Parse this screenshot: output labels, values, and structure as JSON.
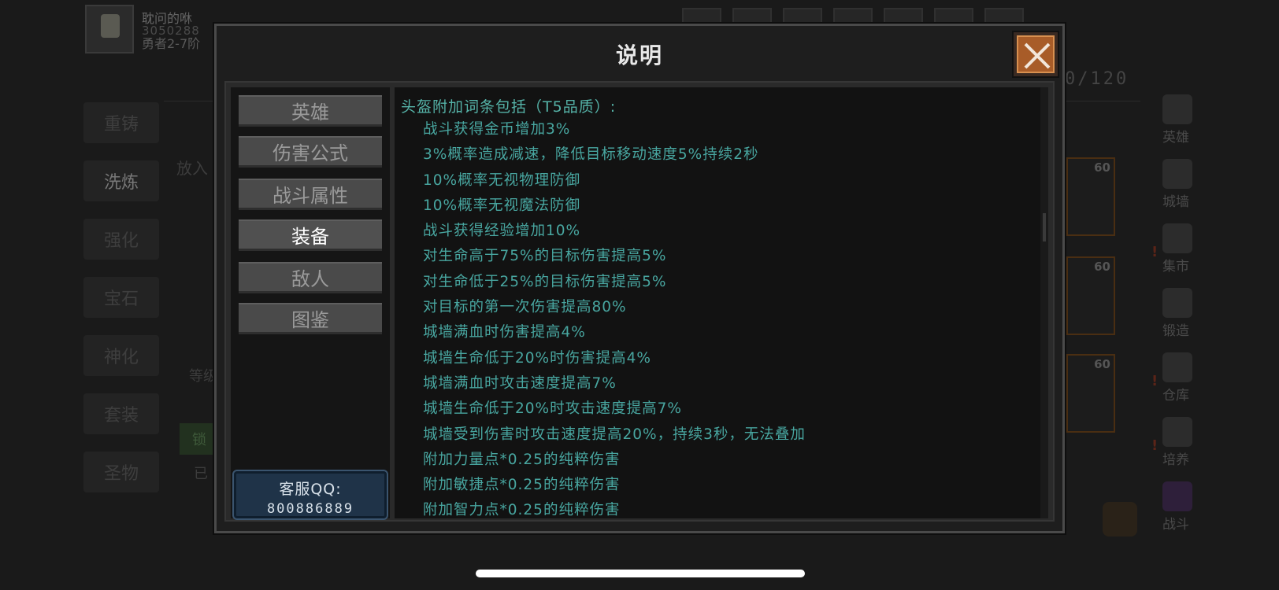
{
  "background": {
    "player_name": "耽问的咻",
    "player_id": "3050288",
    "player_rank": "勇者2-7阶",
    "bag_count": "0/120",
    "left_menu": [
      "重铸",
      "洗炼",
      "强化",
      "宝石",
      "神化",
      "套装",
      "圣物"
    ],
    "put_text": "放入",
    "equip_level_text": "等级",
    "lock_label": "锁",
    "have_text": "已",
    "item_levels": [
      "60",
      "60",
      "60"
    ],
    "right_menu": [
      "英雄",
      "城墙",
      "集市",
      "锻造",
      "仓库",
      "培养",
      "战斗"
    ]
  },
  "modal": {
    "title": "说明",
    "tabs": [
      "英雄",
      "伤害公式",
      "战斗属性",
      "装备",
      "敌人",
      "图鉴"
    ],
    "active_tab": "装备",
    "support_label": "客服QQ:",
    "support_number": "800886889",
    "content_heading": "头盔附加词条包括（T5品质）:",
    "content_lines": [
      "战斗获得金币增加3%",
      "3%概率造成减速，降低目标移动速度5%持续2秒",
      "10%概率无视物理防御",
      "10%概率无视魔法防御",
      "战斗获得经验增加10%",
      "对生命高于75%的目标伤害提高5%",
      "对生命低于25%的目标伤害提高5%",
      "对目标的第一次伤害提高80%",
      "城墙满血时伤害提高4%",
      "城墙生命低于20%时伤害提高4%",
      "城墙满血时攻击速度提高7%",
      "城墙生命低于20%时攻击速度提高7%",
      "城墙受到伤害时攻击速度提高20%，持续3秒，无法叠加",
      "附加力量点*0.25的纯粹伤害",
      "附加敏捷点*0.25的纯粹伤害",
      "附加智力点*0.25的纯粹伤害"
    ]
  },
  "colors": {
    "content_text": "#48a6a0",
    "close_button": "#a85c28",
    "support_bg": "#1f3348"
  },
  "icons": [
    "close-icon"
  ]
}
